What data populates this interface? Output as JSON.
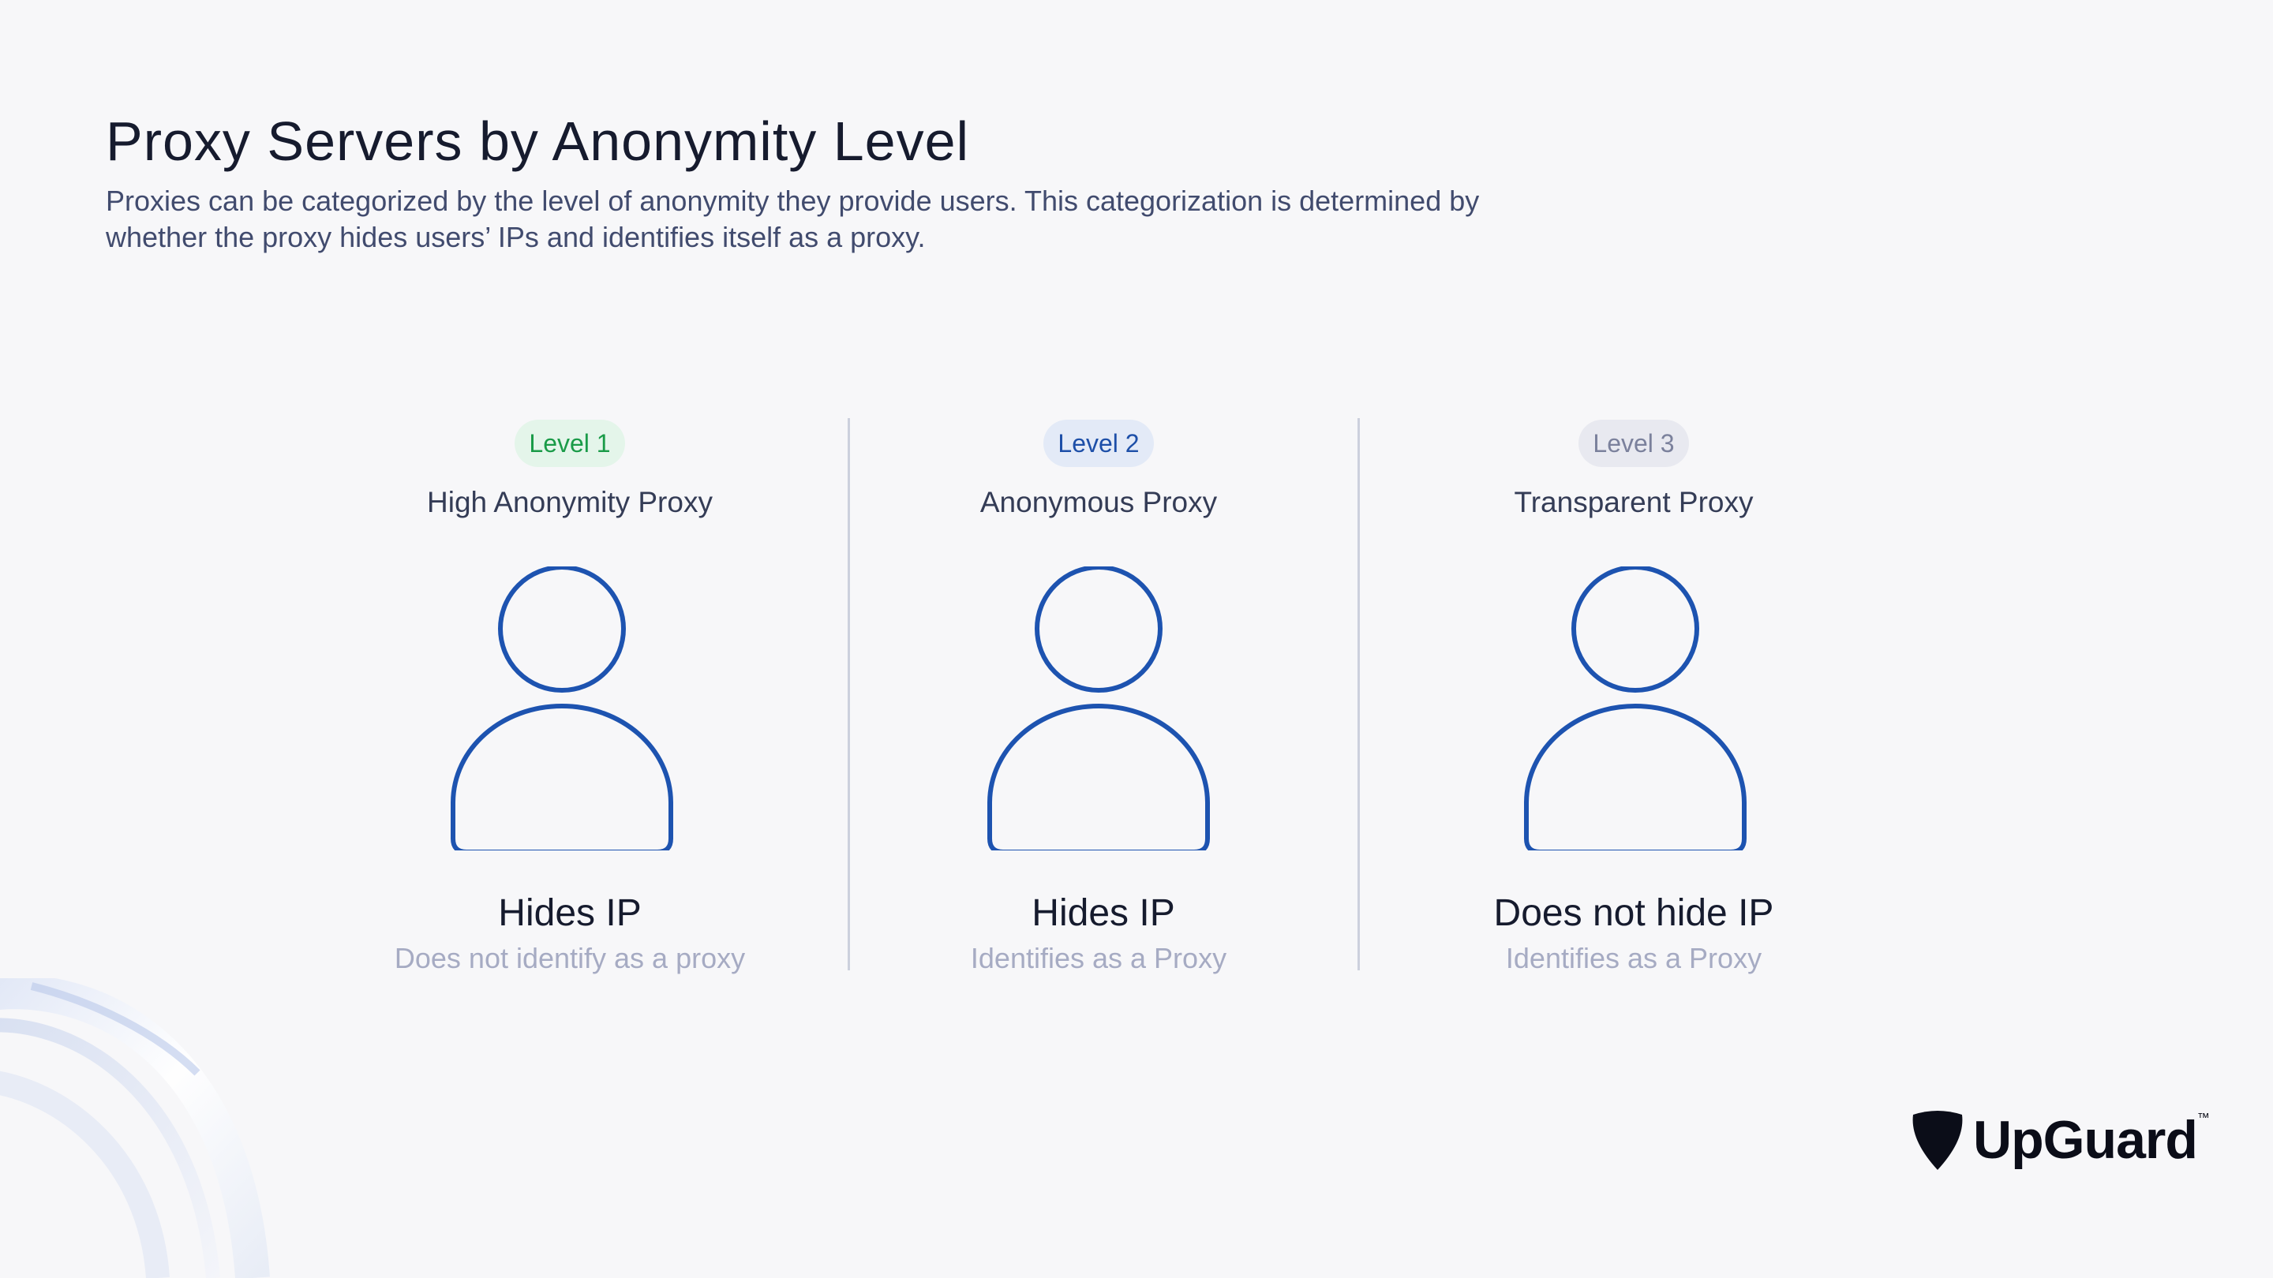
{
  "title": "Proxy Servers by Anonymity Level",
  "subtitle": "Proxies can be categorized by the level of anonymity they provide users. This categorization is determined by whether the proxy hides users’ IPs and identifies itself as a proxy.",
  "levels": [
    {
      "badge": "Level 1",
      "name": "High Anonymity Proxy",
      "ip": "Hides IP",
      "proxy": "Does not identify as a proxy",
      "badge_bg": "#e4f5ea",
      "badge_color": "#1a9b48"
    },
    {
      "badge": "Level 2",
      "name": "Anonymous Proxy",
      "ip": "Hides IP",
      "proxy": "Identifies as a Proxy",
      "badge_bg": "#e3eaf7",
      "badge_color": "#1d4fa8"
    },
    {
      "badge": "Level 3",
      "name": "Transparent Proxy",
      "ip": "Does not hide IP",
      "proxy": "Identifies as a Proxy",
      "badge_bg": "#e8e9f0",
      "badge_color": "#7b819c"
    }
  ],
  "icons": {
    "person": "user-outline-icon",
    "logo": "upguard-shield-icon"
  },
  "colors": {
    "icon_stroke": "#1d53b0",
    "background": "#f7f7f9"
  },
  "brand": {
    "name": "UpGuard",
    "tm": "™"
  }
}
